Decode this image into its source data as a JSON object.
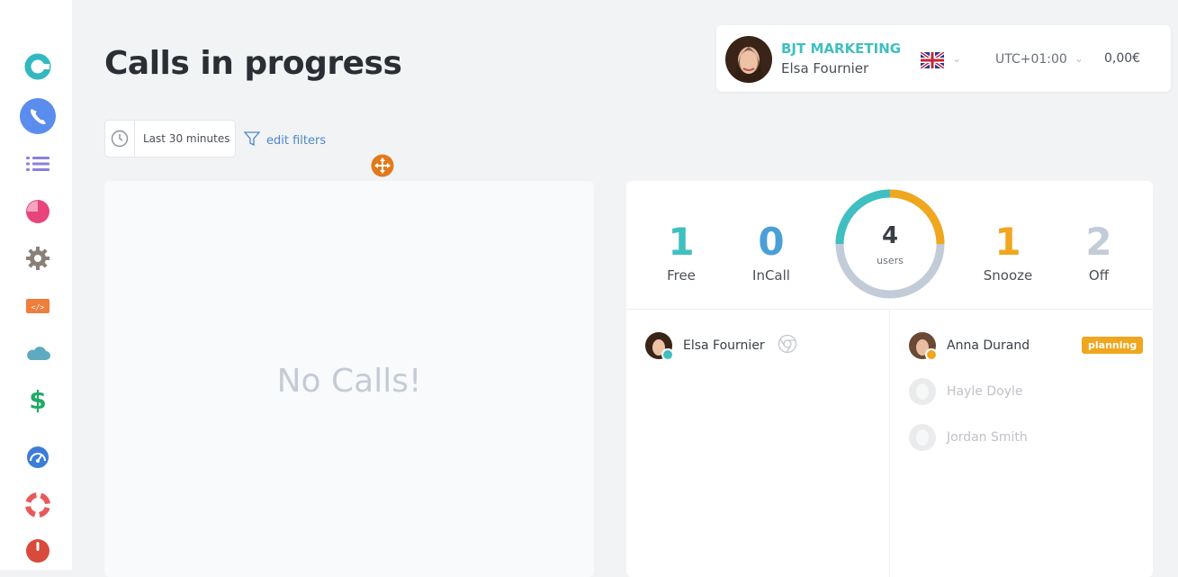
{
  "page": {
    "title": "Calls in progress"
  },
  "account": {
    "company": "BJT MARKETING",
    "user_name": "Elsa Fournier",
    "language_flag": "flag-uk-icon",
    "timezone": "UTC+01:00",
    "balance": "0,00€"
  },
  "sidebar": {
    "items": [
      {
        "name": "logo-icon",
        "color": "#33b8bf"
      },
      {
        "name": "phone-icon",
        "color": "#5b8def",
        "active": true
      },
      {
        "name": "list-icon",
        "color": "#8a7fe0"
      },
      {
        "name": "pie-chart-icon",
        "color": "#e8457d"
      },
      {
        "name": "gear-icon",
        "color": "#8a8079"
      },
      {
        "name": "code-icon",
        "color": "#ef7d3b"
      },
      {
        "name": "cloud-icon",
        "color": "#5eaac0"
      },
      {
        "name": "dollar-icon",
        "color": "#1faa64"
      },
      {
        "name": "gauge-icon",
        "color": "#3b7dd8"
      },
      {
        "name": "lifebuoy-icon",
        "color": "#e85a5a"
      },
      {
        "name": "power-icon",
        "color": "#d84a3a"
      }
    ]
  },
  "filters": {
    "time_range": "Last 30 minutes",
    "edit_label": "edit filters"
  },
  "calls": {
    "empty_message": "No Calls!"
  },
  "users_summary": {
    "free": {
      "count": "1",
      "label": "Free",
      "color": "#3fbfbf"
    },
    "incall": {
      "count": "0",
      "label": "InCall",
      "color": "#4a9fd8"
    },
    "snooze": {
      "count": "1",
      "label": "Snooze",
      "color": "#f0a61e"
    },
    "off": {
      "count": "2",
      "label": "Off",
      "color": "#c2ccd8"
    },
    "total": {
      "count": "4",
      "label": "users"
    }
  },
  "users_left": [
    {
      "name": "Elsa Fournier",
      "status_color": "#3fbfbf",
      "browser_icon": "chrome-icon"
    }
  ],
  "users_right": [
    {
      "name": "Anna Durand",
      "status_color": "#f0a61e",
      "badge": "planning"
    },
    {
      "name": "Hayle Doyle"
    },
    {
      "name": "Jordan Smith"
    }
  ]
}
